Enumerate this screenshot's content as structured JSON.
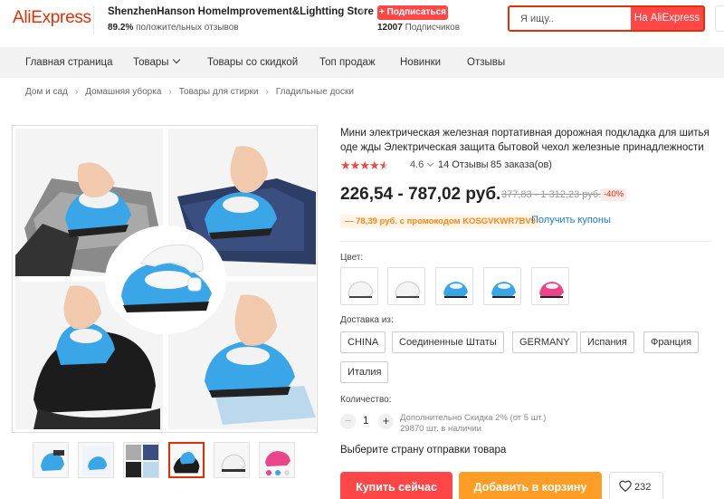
{
  "header": {
    "logo": "AliExpress",
    "store_name": "ShenzhenHanson HomeImprovement&Lightting Store",
    "rating_value": "89.2%",
    "rating_text": "положительных отзывов",
    "subscribe_label": "+ Подписаться",
    "subscribers_count": "12007",
    "subscribers_text": "Подписчиков",
    "search_placeholder": "Я ищу..",
    "search_button": "На AliExpress"
  },
  "nav": {
    "items": [
      "Главная страница",
      "Товары",
      "Товары со скидкой",
      "Топ продаж",
      "Новинки",
      "Отзывы"
    ]
  },
  "breadcrumb": [
    "Дом и сад",
    "Домашняя уборка",
    "Товары для стирки",
    "Гладильные доски"
  ],
  "product": {
    "title": "Мини электрическая железная портативная дорожная подкладка для шитья оде жды Электрическая защита бытовой чехол железные принадлежности",
    "rating": "4.6",
    "rating_fraction": 0.92,
    "reviews": "14 Отзывы",
    "orders": "85 заказа(ов)",
    "price": "226,54 - 787,02 руб.",
    "old_price": "377,83 - 1 312,23 руб.",
    "discount": "-40%",
    "promo": "— 78,39 руб. с промокодом KOSGVKWR7BV9",
    "coupons_link": "Получить купоны"
  },
  "options": {
    "color_label": "Цвет:",
    "colors": [
      "white",
      "white",
      "blue",
      "blue",
      "pink"
    ],
    "shipping_label": "Доставка из:",
    "shipping_from": [
      "CHINA",
      "Соединенные Штаты",
      "GERMANY",
      "Испания",
      "Франция",
      "Италия"
    ],
    "quantity_label": "Количество:",
    "quantity": "1",
    "minus": "−",
    "plus": "+",
    "quantity_discount": "Дополнительно Скидка 2% (от 5 шт.)",
    "stock": "29870 шт. в наличии",
    "ship_country": "Выберите страну отправки товара"
  },
  "actions": {
    "buy_now": "Купить сейчас",
    "add_to_cart": "Добавить в корзину",
    "wishlist_count": "232"
  },
  "colors": {
    "accent": "#e62e04",
    "button_red": "#ff4747",
    "button_orange": "#ff9d26",
    "link": "#1a7bd1",
    "iron_blue": "#3aa6e8",
    "iron_pink": "#e8458a"
  }
}
